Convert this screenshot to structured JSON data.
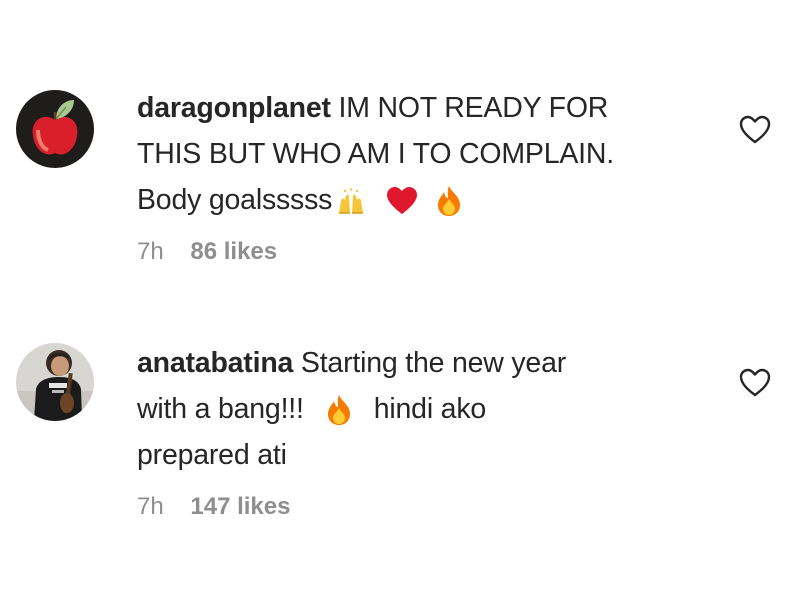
{
  "comments": [
    {
      "username": "daragonplanet",
      "line1": "IM NOT READY FOR",
      "line2": "THIS BUT WHO AM I TO COMPLAIN.",
      "line3": "Body goalsssss",
      "emojis": [
        "raising-hands-emoji",
        "red-heart-emoji",
        "fire-emoji"
      ],
      "time": "7h",
      "likes": "86 likes"
    },
    {
      "username": "anatabatina",
      "line1": "Starting the new year",
      "line2a": "with a bang!!!",
      "line2b": "hindi ako",
      "line3": "prepared ati",
      "emojis": [
        "fire-emoji"
      ],
      "time": "7h",
      "likes": "147 likes"
    }
  ],
  "icons": {
    "like": "heart-outline-icon"
  },
  "colors": {
    "text": "#262626",
    "meta": "#8e8e8e",
    "heart_red": "#e0182d",
    "fire": "#f57c00"
  }
}
